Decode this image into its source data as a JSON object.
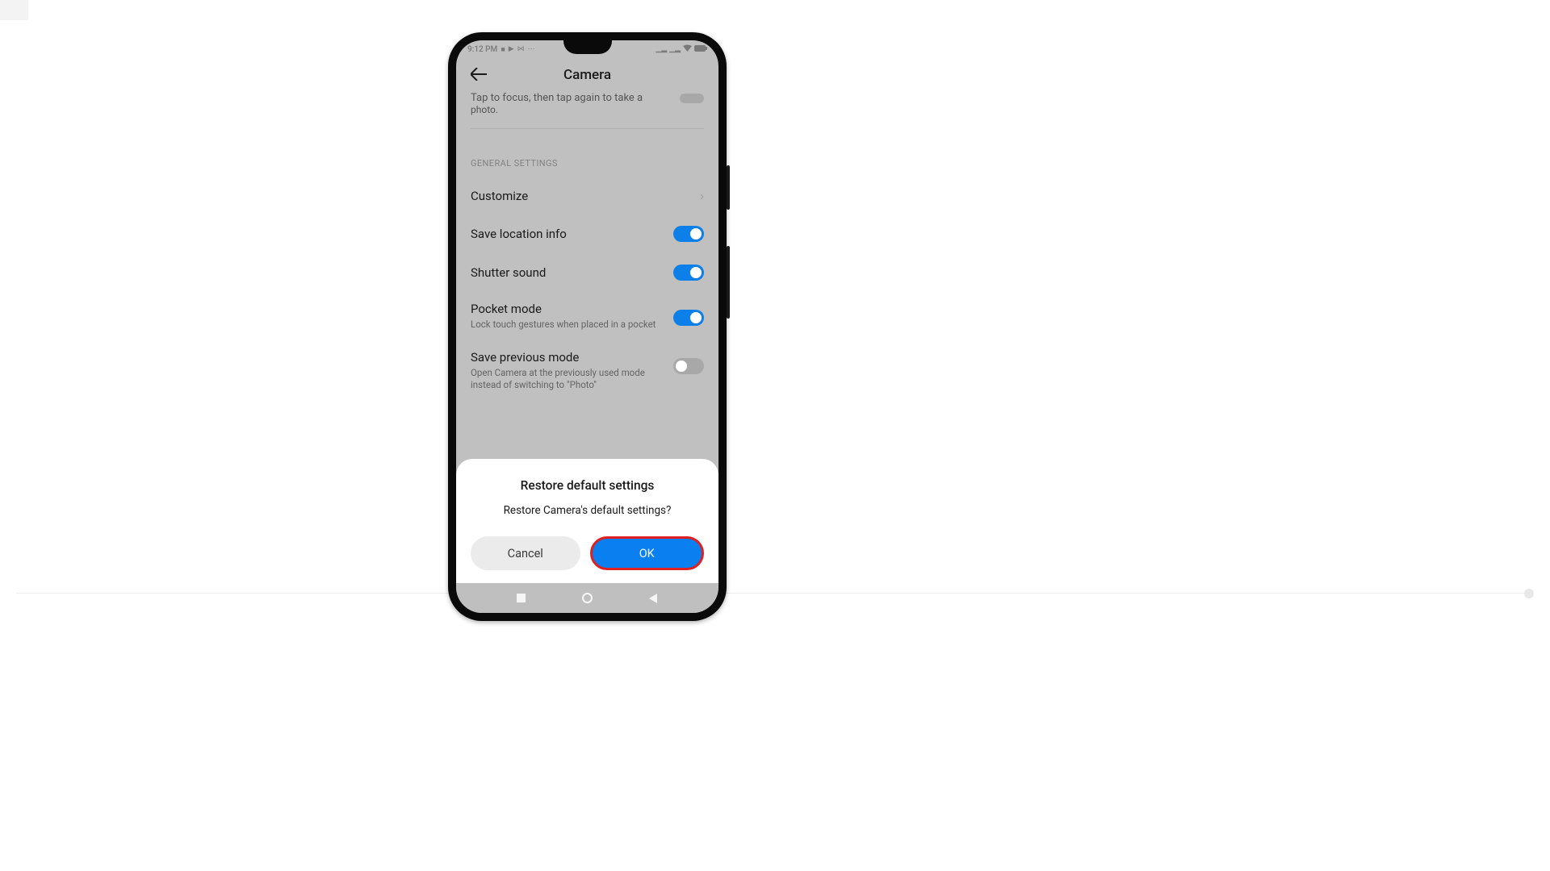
{
  "status": {
    "time": "9:12 PM",
    "icons_left": "■ ▶ ⋈ ⋯",
    "icons_right_signal": "▁▂",
    "icons_right_wifi": "📶",
    "icons_right_batt": "▬"
  },
  "header": {
    "title": "Camera"
  },
  "truncated": {
    "line1": "Tap to focus, then tap again to take a",
    "line2": "photo."
  },
  "section": {
    "label": "GENERAL SETTINGS"
  },
  "settings": {
    "customize": "Customize",
    "location": "Save location info",
    "shutter": "Shutter sound",
    "pocket_title": "Pocket mode",
    "pocket_sub": "Lock touch gestures when placed in a pocket",
    "prev_title": "Save previous mode",
    "prev_sub": "Open Camera at the previously used mode instead of switching to \"Photo\""
  },
  "dialog": {
    "title": "Restore default settings",
    "message": "Restore Camera's default settings?",
    "cancel": "Cancel",
    "ok": "OK"
  }
}
